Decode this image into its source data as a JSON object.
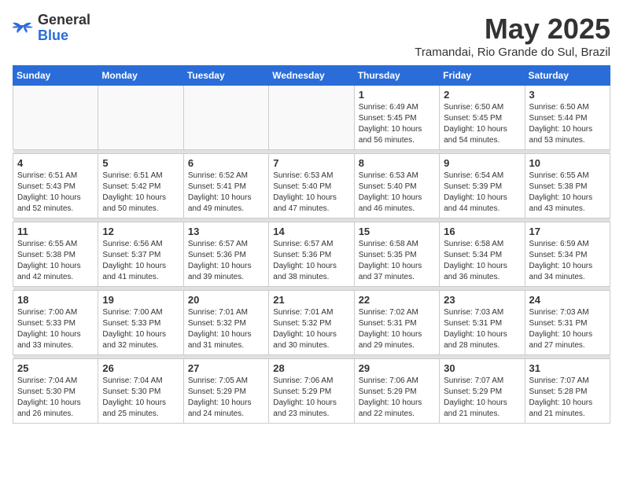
{
  "header": {
    "logo_general": "General",
    "logo_blue": "Blue",
    "month_title": "May 2025",
    "subtitle": "Tramandai, Rio Grande do Sul, Brazil"
  },
  "days_of_week": [
    "Sunday",
    "Monday",
    "Tuesday",
    "Wednesday",
    "Thursday",
    "Friday",
    "Saturday"
  ],
  "weeks": [
    [
      {
        "day": "",
        "info": ""
      },
      {
        "day": "",
        "info": ""
      },
      {
        "day": "",
        "info": ""
      },
      {
        "day": "",
        "info": ""
      },
      {
        "day": "1",
        "info": "Sunrise: 6:49 AM\nSunset: 5:45 PM\nDaylight: 10 hours\nand 56 minutes."
      },
      {
        "day": "2",
        "info": "Sunrise: 6:50 AM\nSunset: 5:45 PM\nDaylight: 10 hours\nand 54 minutes."
      },
      {
        "day": "3",
        "info": "Sunrise: 6:50 AM\nSunset: 5:44 PM\nDaylight: 10 hours\nand 53 minutes."
      }
    ],
    [
      {
        "day": "4",
        "info": "Sunrise: 6:51 AM\nSunset: 5:43 PM\nDaylight: 10 hours\nand 52 minutes."
      },
      {
        "day": "5",
        "info": "Sunrise: 6:51 AM\nSunset: 5:42 PM\nDaylight: 10 hours\nand 50 minutes."
      },
      {
        "day": "6",
        "info": "Sunrise: 6:52 AM\nSunset: 5:41 PM\nDaylight: 10 hours\nand 49 minutes."
      },
      {
        "day": "7",
        "info": "Sunrise: 6:53 AM\nSunset: 5:40 PM\nDaylight: 10 hours\nand 47 minutes."
      },
      {
        "day": "8",
        "info": "Sunrise: 6:53 AM\nSunset: 5:40 PM\nDaylight: 10 hours\nand 46 minutes."
      },
      {
        "day": "9",
        "info": "Sunrise: 6:54 AM\nSunset: 5:39 PM\nDaylight: 10 hours\nand 44 minutes."
      },
      {
        "day": "10",
        "info": "Sunrise: 6:55 AM\nSunset: 5:38 PM\nDaylight: 10 hours\nand 43 minutes."
      }
    ],
    [
      {
        "day": "11",
        "info": "Sunrise: 6:55 AM\nSunset: 5:38 PM\nDaylight: 10 hours\nand 42 minutes."
      },
      {
        "day": "12",
        "info": "Sunrise: 6:56 AM\nSunset: 5:37 PM\nDaylight: 10 hours\nand 41 minutes."
      },
      {
        "day": "13",
        "info": "Sunrise: 6:57 AM\nSunset: 5:36 PM\nDaylight: 10 hours\nand 39 minutes."
      },
      {
        "day": "14",
        "info": "Sunrise: 6:57 AM\nSunset: 5:36 PM\nDaylight: 10 hours\nand 38 minutes."
      },
      {
        "day": "15",
        "info": "Sunrise: 6:58 AM\nSunset: 5:35 PM\nDaylight: 10 hours\nand 37 minutes."
      },
      {
        "day": "16",
        "info": "Sunrise: 6:58 AM\nSunset: 5:34 PM\nDaylight: 10 hours\nand 36 minutes."
      },
      {
        "day": "17",
        "info": "Sunrise: 6:59 AM\nSunset: 5:34 PM\nDaylight: 10 hours\nand 34 minutes."
      }
    ],
    [
      {
        "day": "18",
        "info": "Sunrise: 7:00 AM\nSunset: 5:33 PM\nDaylight: 10 hours\nand 33 minutes."
      },
      {
        "day": "19",
        "info": "Sunrise: 7:00 AM\nSunset: 5:33 PM\nDaylight: 10 hours\nand 32 minutes."
      },
      {
        "day": "20",
        "info": "Sunrise: 7:01 AM\nSunset: 5:32 PM\nDaylight: 10 hours\nand 31 minutes."
      },
      {
        "day": "21",
        "info": "Sunrise: 7:01 AM\nSunset: 5:32 PM\nDaylight: 10 hours\nand 30 minutes."
      },
      {
        "day": "22",
        "info": "Sunrise: 7:02 AM\nSunset: 5:31 PM\nDaylight: 10 hours\nand 29 minutes."
      },
      {
        "day": "23",
        "info": "Sunrise: 7:03 AM\nSunset: 5:31 PM\nDaylight: 10 hours\nand 28 minutes."
      },
      {
        "day": "24",
        "info": "Sunrise: 7:03 AM\nSunset: 5:31 PM\nDaylight: 10 hours\nand 27 minutes."
      }
    ],
    [
      {
        "day": "25",
        "info": "Sunrise: 7:04 AM\nSunset: 5:30 PM\nDaylight: 10 hours\nand 26 minutes."
      },
      {
        "day": "26",
        "info": "Sunrise: 7:04 AM\nSunset: 5:30 PM\nDaylight: 10 hours\nand 25 minutes."
      },
      {
        "day": "27",
        "info": "Sunrise: 7:05 AM\nSunset: 5:29 PM\nDaylight: 10 hours\nand 24 minutes."
      },
      {
        "day": "28",
        "info": "Sunrise: 7:06 AM\nSunset: 5:29 PM\nDaylight: 10 hours\nand 23 minutes."
      },
      {
        "day": "29",
        "info": "Sunrise: 7:06 AM\nSunset: 5:29 PM\nDaylight: 10 hours\nand 22 minutes."
      },
      {
        "day": "30",
        "info": "Sunrise: 7:07 AM\nSunset: 5:29 PM\nDaylight: 10 hours\nand 21 minutes."
      },
      {
        "day": "31",
        "info": "Sunrise: 7:07 AM\nSunset: 5:28 PM\nDaylight: 10 hours\nand 21 minutes."
      }
    ]
  ]
}
